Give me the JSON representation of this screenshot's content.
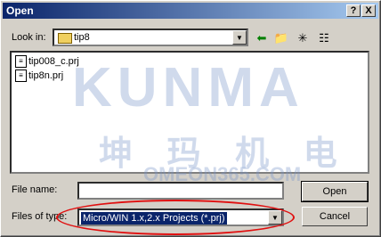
{
  "window": {
    "title": "Open",
    "help_glyph": "?",
    "close_glyph": "X"
  },
  "look_in": {
    "label": "Look in:",
    "value": "tip8"
  },
  "files": [
    {
      "name": "tip008_c.prj"
    },
    {
      "name": "tip8n.prj"
    }
  ],
  "watermark": {
    "brand": "KUNMA",
    "chinese": "坤 玛 机 电",
    "site": "OMEON365.COM"
  },
  "file_name": {
    "label": "File name:",
    "value": ""
  },
  "files_of_type": {
    "label": "Files of type:",
    "value": "Micro/WIN 1.x,2.x Projects (*.prj)"
  },
  "buttons": {
    "open": "Open",
    "cancel": "Cancel"
  }
}
